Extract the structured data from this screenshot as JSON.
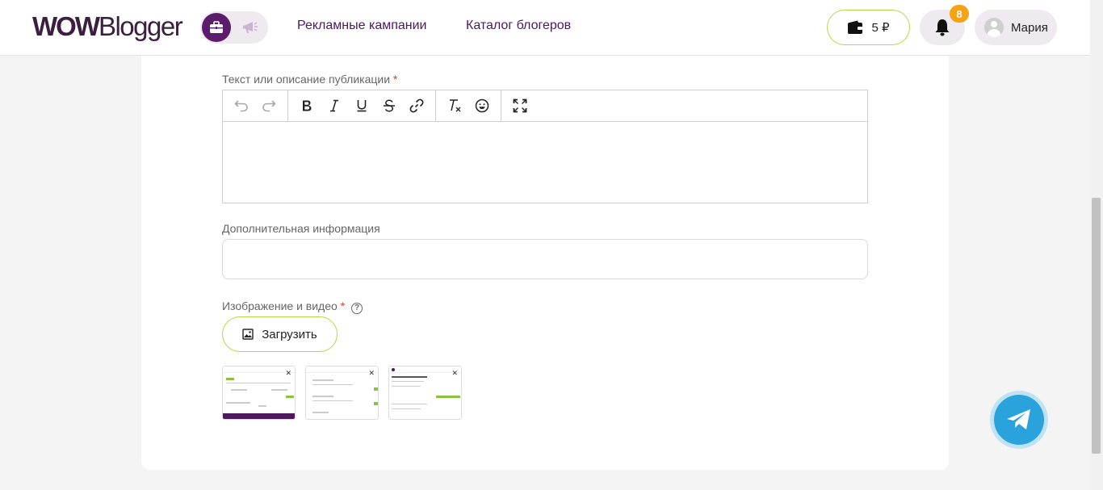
{
  "header": {
    "logo_bold": "WOW",
    "logo_regular": "Blogger",
    "nav": [
      "Рекламные кампании",
      "Каталог блогеров"
    ],
    "wallet_amount": "5 ₽",
    "notifications_count": "8",
    "user_name": "Мария"
  },
  "form": {
    "text_label": "Текст или описание публикации",
    "required_mark": "*",
    "additional_label": "Дополнительная информация",
    "additional_value": "",
    "media_label": "Изображение и видео",
    "help_glyph": "?",
    "upload_label": "Загрузить"
  },
  "toolbar": {
    "groups": [
      [
        "undo-icon",
        "redo-icon"
      ],
      [
        "bold-icon",
        "italic-icon",
        "underline-icon",
        "strikethrough-icon",
        "link-icon"
      ],
      [
        "clear-format-icon",
        "emoji-icon"
      ],
      [
        "fullscreen-icon"
      ]
    ]
  },
  "colors": {
    "brand_purple": "#4a1a5c",
    "accent_green": "#b6d84a",
    "badge_orange": "#f5a315",
    "telegram_blue": "#2aa3dc"
  }
}
